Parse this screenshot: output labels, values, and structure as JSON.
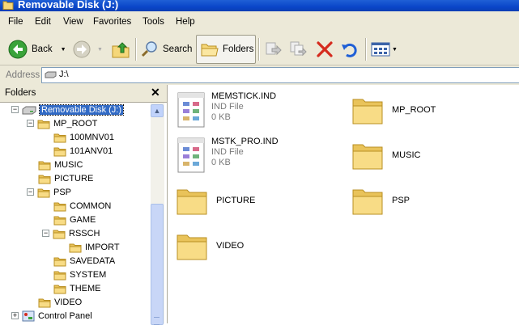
{
  "window": {
    "title": "Removable Disk (J:)"
  },
  "menu": [
    "File",
    "Edit",
    "View",
    "Favorites",
    "Tools",
    "Help"
  ],
  "toolbar": {
    "back_label": "Back",
    "search_label": "Search",
    "folders_label": "Folders"
  },
  "address": {
    "label": "Address",
    "value": "J:\\"
  },
  "folders_pane": {
    "title": "Folders",
    "close_glyph": "✕",
    "tree": [
      {
        "label": "Removable Disk (J:)",
        "level": 0,
        "expander": "−",
        "icon": "drive-icon",
        "selected": true
      },
      {
        "label": "MP_ROOT",
        "level": 1,
        "expander": "−",
        "icon": "folder-icon"
      },
      {
        "label": "100MNV01",
        "level": 2,
        "expander": "",
        "icon": "folder-icon"
      },
      {
        "label": "101ANV01",
        "level": 2,
        "expander": "",
        "icon": "folder-icon"
      },
      {
        "label": "MUSIC",
        "level": 1,
        "expander": "",
        "icon": "folder-icon"
      },
      {
        "label": "PICTURE",
        "level": 1,
        "expander": "",
        "icon": "folder-icon"
      },
      {
        "label": "PSP",
        "level": 1,
        "expander": "−",
        "icon": "folder-icon"
      },
      {
        "label": "COMMON",
        "level": 2,
        "expander": "",
        "icon": "folder-icon"
      },
      {
        "label": "GAME",
        "level": 2,
        "expander": "",
        "icon": "folder-icon"
      },
      {
        "label": "RSSCH",
        "level": 2,
        "expander": "−",
        "icon": "folder-icon"
      },
      {
        "label": "IMPORT",
        "level": 3,
        "expander": "",
        "icon": "folder-icon"
      },
      {
        "label": "SAVEDATA",
        "level": 2,
        "expander": "",
        "icon": "folder-icon"
      },
      {
        "label": "SYSTEM",
        "level": 2,
        "expander": "",
        "icon": "folder-icon"
      },
      {
        "label": "THEME",
        "level": 2,
        "expander": "",
        "icon": "folder-icon"
      },
      {
        "label": "VIDEO",
        "level": 1,
        "expander": "",
        "icon": "folder-icon"
      },
      {
        "label": "Control Panel",
        "level": 0,
        "expander": "+",
        "icon": "control-panel-icon"
      }
    ]
  },
  "files": [
    {
      "name": "MEMSTICK.IND",
      "type": "IND File",
      "size": "0 KB"
    },
    {
      "name": "MSTK_PRO.IND",
      "type": "IND File",
      "size": "0 KB"
    }
  ],
  "folders": [
    "MP_ROOT",
    "MUSIC",
    "PICTURE",
    "PSP",
    "VIDEO"
  ],
  "colors": {
    "titlebar": "#0a46c9",
    "selection": "#316ac5",
    "chrome": "#ece9d8",
    "folder": "#f5d77a"
  }
}
